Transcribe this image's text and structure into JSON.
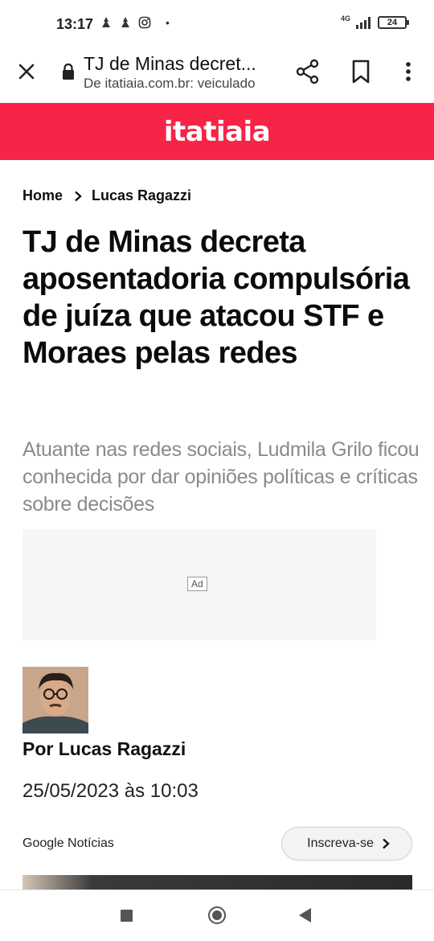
{
  "status_bar": {
    "time": "13:17",
    "network": "4G",
    "battery": "24"
  },
  "browser": {
    "tab_title": "TJ de Minas decret...",
    "url_text": "De itatiaia.com.br: veiculado",
    "icons": [
      "close-icon",
      "lock-icon",
      "share-icon",
      "bookmark-icon",
      "more-vert-icon"
    ]
  },
  "site": {
    "logo": "itatiaia",
    "brand_color": "#f72448"
  },
  "breadcrumb": {
    "home": "Home",
    "current": "Lucas Ragazzi"
  },
  "article": {
    "headline": "TJ de Minas decreta aposentadoria compulsória de juíza que atacou STF e Moraes pelas redes",
    "subheadline": "Atuante nas redes sociais, Ludmila Grilo ficou conhecida por dar opiniões políticas e críticas sobre decisões",
    "ad_label": "Ad",
    "author": "Por Lucas Ragazzi",
    "date": "25/05/2023 às 10:03"
  },
  "google_news": {
    "label": "Google Notícias",
    "button": "Inscreva-se"
  }
}
